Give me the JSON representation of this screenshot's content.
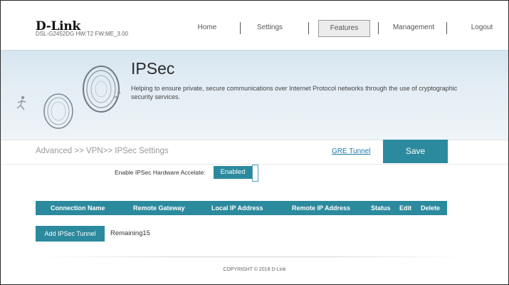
{
  "header": {
    "logo": "D-Link",
    "model_info": "DSL-G2452DG  HW:T2  FW:ME_3.00"
  },
  "nav": [
    {
      "label": "Home",
      "active": false
    },
    {
      "label": "Settings",
      "active": false
    },
    {
      "label": "Features",
      "active": true
    },
    {
      "label": "Management",
      "active": false
    },
    {
      "label": "Logout",
      "active": false
    }
  ],
  "banner": {
    "title": "IPSec",
    "description": "Helping to ensure private, secure communications over Internet Protocol networks through the use of cryptographic security services."
  },
  "breadcrumb": "Advanced >> VPN>> IPSec Settings",
  "gre_tunnel_link": "GRE Tunnel",
  "save_label": "Save",
  "hw_accelerate": {
    "label": "Enable IPSec Hardware Accelate:",
    "value": "Enabled"
  },
  "table": {
    "columns": [
      "Connection Name",
      "Remote Gateway",
      "Local IP Address",
      "Remote IP Address",
      "Status",
      "Edit",
      "Delete"
    ],
    "rows": []
  },
  "add_tunnel_label": "Add IPSec Tunnel",
  "remaining_text": "Remaining15",
  "copyright": "COPYRIGHT © 2018 D-Link",
  "colors": {
    "accent": "#2c8a9e",
    "link": "#1d7aa8",
    "banner": "#dde9f1"
  }
}
